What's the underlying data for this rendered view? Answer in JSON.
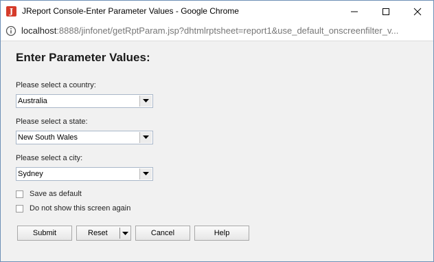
{
  "window": {
    "title": "JReport Console-Enter Parameter Values - Google Chrome",
    "app_icon_letter": "J"
  },
  "address": {
    "host": "localhost",
    "rest": ":8888/jinfonet/getRptParam.jsp?dhtmlrptsheet=report1&use_default_onscreenfilter_v..."
  },
  "form": {
    "heading": "Enter Parameter Values:",
    "country": {
      "label": "Please select a country:",
      "value": "Australia"
    },
    "state": {
      "label": "Please select a state:",
      "value": "New South Wales"
    },
    "city": {
      "label": "Please select a city:",
      "value": "Sydney"
    },
    "save_default": {
      "label": "Save as default",
      "checked": false
    },
    "dont_show": {
      "label": "Do not show this screen again",
      "checked": false
    }
  },
  "buttons": {
    "submit": "Submit",
    "reset": "Reset",
    "cancel": "Cancel",
    "help": "Help"
  },
  "icons": {
    "app": "jreport-app-icon",
    "info": "info-icon",
    "minimize": "minimize-icon",
    "maximize": "maximize-icon",
    "close": "close-icon",
    "dropdown": "chevron-down-icon"
  },
  "colors": {
    "app_icon": "#d53b2a",
    "content_bg": "#f1f1f1",
    "window_border": "#6d8fb6"
  }
}
